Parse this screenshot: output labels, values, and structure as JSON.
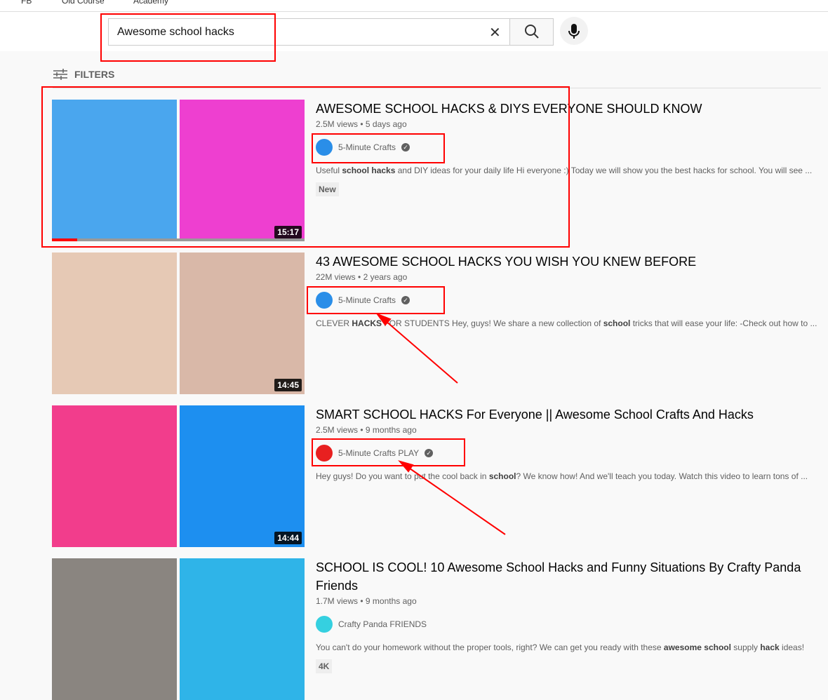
{
  "bookmarks": [
    "FB",
    "Old Course",
    "Academy"
  ],
  "search": {
    "query": "Awesome school hacks"
  },
  "filters_label": "FILTERS",
  "results": [
    {
      "title": "AWESOME SCHOOL HACKS & DIYS EVERYONE SHOULD KNOW",
      "views": "2.5M views",
      "age": "5 days ago",
      "channel": "5-Minute Crafts",
      "verified": true,
      "desc_parts": [
        "Useful ",
        "school hacks",
        " and DIY ideas for your daily life Hi everyone :) Today we will show you the best hacks for school. You will see ..."
      ],
      "badge": "New",
      "duration": "15:17",
      "colors": [
        "#4aa6ee",
        "#ee3fd0"
      ],
      "avatar": "#2a8ee8"
    },
    {
      "title": "43 AWESOME SCHOOL HACKS YOU WISH YOU KNEW BEFORE",
      "views": "22M views",
      "age": "2 years ago",
      "channel": "5-Minute Crafts",
      "verified": true,
      "desc_parts": [
        "CLEVER ",
        "HACKS",
        " FOR STUDENTS Hey, guys! We share a new collection of ",
        "school",
        " tricks that will ease your life: -Check out how to ..."
      ],
      "duration": "14:45",
      "colors": [
        "#e6c9b5",
        "#d9b8a8"
      ],
      "avatar": "#2a8ee8"
    },
    {
      "title": "SMART SCHOOL HACKS For Everyone || Awesome School Crafts And Hacks",
      "views": "2.5M views",
      "age": "9 months ago",
      "channel": "5-Minute Crafts PLAY",
      "verified": true,
      "desc_parts": [
        "Hey guys! Do you want to put the cool back in ",
        "school",
        "? We know how! And we'll teach you today. Watch this video to learn tons of ..."
      ],
      "duration": "14:44",
      "colors": [
        "#f23d8c",
        "#1d8ff0"
      ],
      "avatar": "#e82020"
    },
    {
      "title": "SCHOOL IS COOL! 10 Awesome School Hacks and Funny Situations By Crafty Panda Friends",
      "views": "1.7M views",
      "age": "9 months ago",
      "channel": "Crafty Panda FRIENDS",
      "verified": false,
      "desc_parts": [
        "You can't do your homework without the proper tools, right? We can get you ready with these ",
        "awesome school",
        " supply ",
        "hack",
        " ideas!"
      ],
      "badge": "4K",
      "colors": [
        "#8a8580",
        "#2fb4e8"
      ],
      "avatar": "#35d0e0"
    }
  ],
  "annotation_color": "#ff0000"
}
